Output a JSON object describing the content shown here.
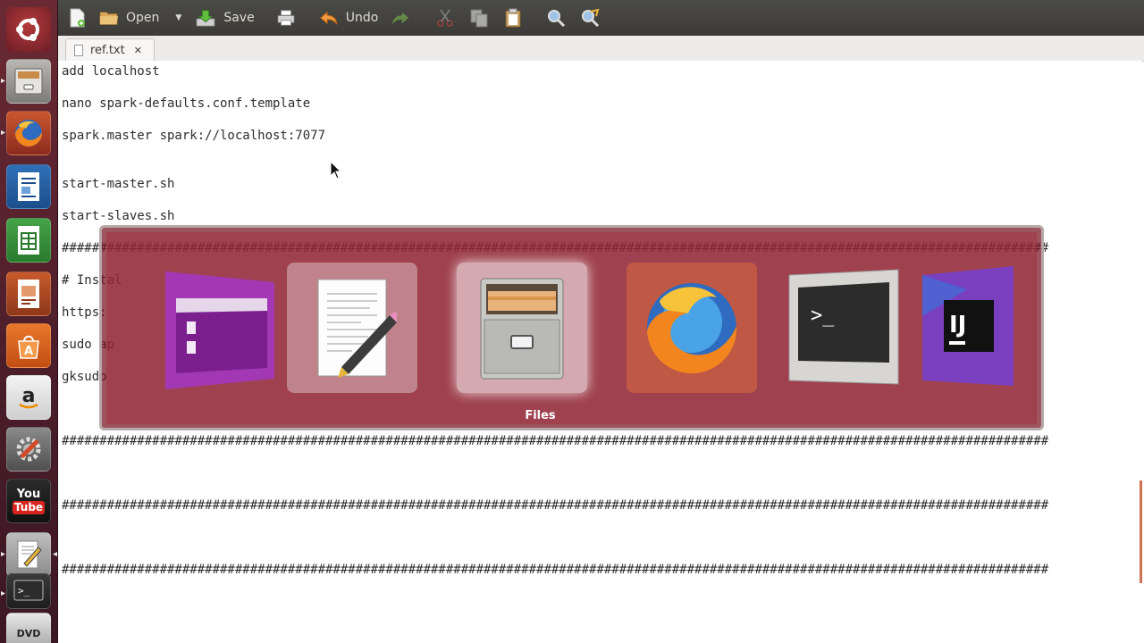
{
  "toolbar": {
    "open_label": "Open",
    "save_label": "Save",
    "undo_label": "Undo"
  },
  "tab": {
    "title": "ref.txt",
    "close": "✕"
  },
  "editor": {
    "lines": [
      "add localhost",
      "nano spark-defaults.conf.template",
      "spark.master spark://localhost:7077",
      "start-master.sh",
      "start-slaves.sh",
      "###################################################################################################################################",
      "# Instal",
      "https:",
      "sudo ap",
      "gksudo",
      "###################################################################################################################################",
      "###################################################################################################################################",
      "###################################################################################################################################"
    ]
  },
  "switcher": {
    "selected_label": "Files",
    "apps": [
      "Nautilus",
      "Text Editor",
      "Files",
      "Firefox",
      "Terminal",
      "IntelliJ IDEA"
    ]
  },
  "launcher": {
    "apps": [
      "Dash",
      "Files",
      "Firefox",
      "Writer",
      "Calc",
      "Impress",
      "Software Center",
      "Amazon",
      "System Settings",
      "YouTube",
      "Text Editor",
      "Terminal",
      "DVD"
    ],
    "youtube_label_top": "You",
    "youtube_label_bottom": "Tube",
    "dvd_label": "DVD"
  },
  "colors": {
    "launcher_bg": "#4a1d2a",
    "toolbar_bg": "#3c3b37",
    "switcher_bg": "#8c2434",
    "accent": "#dd4814"
  }
}
